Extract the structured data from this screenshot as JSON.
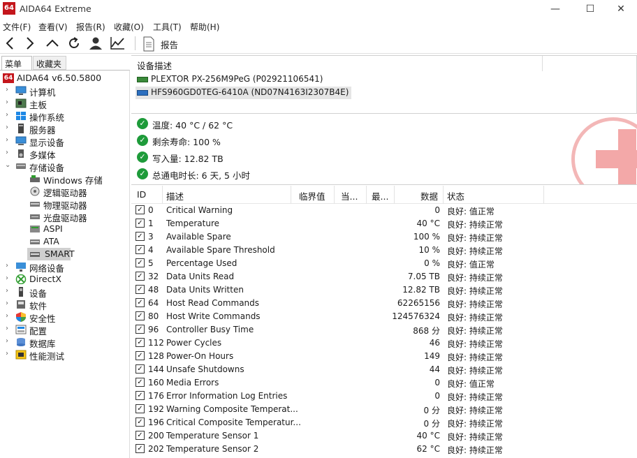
{
  "window": {
    "logo_text": "64",
    "title": "AIDA64 Extreme",
    "minimize": "—",
    "maximize": "☐",
    "close": "✕"
  },
  "menu": [
    "文件(F)",
    "查看(V)",
    "报告(R)",
    "收藏(O)",
    "工具(T)",
    "帮助(H)"
  ],
  "toolbar": {
    "report_label": "报告"
  },
  "left_tabs": {
    "menu": "菜单",
    "favorites": "收藏夹"
  },
  "tree": {
    "root": "AIDA64 v6.50.5800",
    "items": [
      {
        "label": "计算机",
        "expanded": false
      },
      {
        "label": "主板",
        "expanded": false
      },
      {
        "label": "操作系统",
        "expanded": false
      },
      {
        "label": "服务器",
        "expanded": false
      },
      {
        "label": "显示设备",
        "expanded": false
      },
      {
        "label": "多媒体",
        "expanded": false
      },
      {
        "label": "存储设备",
        "expanded": true
      }
    ],
    "storage_children": [
      "Windows 存储",
      "逻辑驱动器",
      "物理驱动器",
      "光盘驱动器",
      "ASPI",
      "ATA",
      "SMART"
    ],
    "items_after": [
      "网络设备",
      "DirectX",
      "设备",
      "软件",
      "安全性",
      "配置",
      "数据库",
      "性能测试"
    ]
  },
  "device_desc": {
    "header": "设备描述",
    "devices": [
      {
        "label": "PLEXTOR PX-256M9PeG (P02921106541)",
        "selected": false
      },
      {
        "label": "HFS960GD0TEG-6410A (ND07N4163I2307B4E)",
        "selected": true
      }
    ]
  },
  "status": [
    "温度: 40 °C / 62 °C",
    "剩余寿命: 100 %",
    "写入量: 12.82 TB",
    "总通电时长: 6 天, 5 小时"
  ],
  "table": {
    "headers": {
      "id": "ID",
      "desc": "描述",
      "threshold": "临界值",
      "current": "当...",
      "worst": "最...",
      "data": "数据",
      "status": "状态"
    },
    "rows": [
      {
        "id": "0",
        "desc": "Critical Warning",
        "data": "0",
        "status": "良好: 值正常"
      },
      {
        "id": "1",
        "desc": "Temperature",
        "data": "40 °C",
        "status": "良好: 持续正常"
      },
      {
        "id": "3",
        "desc": "Available Spare",
        "data": "100 %",
        "status": "良好: 持续正常"
      },
      {
        "id": "4",
        "desc": "Available Spare Threshold",
        "data": "10 %",
        "status": "良好: 持续正常"
      },
      {
        "id": "5",
        "desc": "Percentage Used",
        "data": "0 %",
        "status": "良好: 值正常"
      },
      {
        "id": "32",
        "desc": "Data Units Read",
        "data": "7.05 TB",
        "status": "良好: 持续正常"
      },
      {
        "id": "48",
        "desc": "Data Units Written",
        "data": "12.82 TB",
        "status": "良好: 持续正常"
      },
      {
        "id": "64",
        "desc": "Host Read Commands",
        "data": "62265156",
        "status": "良好: 持续正常"
      },
      {
        "id": "80",
        "desc": "Host Write Commands",
        "data": "124576324",
        "status": "良好: 持续正常"
      },
      {
        "id": "96",
        "desc": "Controller Busy Time",
        "data": "868 分",
        "status": "良好: 持续正常"
      },
      {
        "id": "112",
        "desc": "Power Cycles",
        "data": "46",
        "status": "良好: 持续正常"
      },
      {
        "id": "128",
        "desc": "Power-On Hours",
        "data": "149",
        "status": "良好: 持续正常"
      },
      {
        "id": "144",
        "desc": "Unsafe Shutdowns",
        "data": "44",
        "status": "良好: 持续正常"
      },
      {
        "id": "160",
        "desc": "Media Errors",
        "data": "0",
        "status": "良好: 值正常"
      },
      {
        "id": "176",
        "desc": "Error Information Log Entries",
        "data": "0",
        "status": "良好: 持续正常"
      },
      {
        "id": "192",
        "desc": "Warning Composite Temperat...",
        "data": "0 分",
        "status": "良好: 持续正常"
      },
      {
        "id": "196",
        "desc": "Critical Composite Temperatur...",
        "data": "0 分",
        "status": "良好: 持续正常"
      },
      {
        "id": "200",
        "desc": "Temperature Sensor 1",
        "data": "40 °C",
        "status": "良好: 持续正常"
      },
      {
        "id": "202",
        "desc": "Temperature Sensor 2",
        "data": "62 °C",
        "status": "良好: 持续正常"
      }
    ]
  },
  "colors": {
    "accent_red": "#c4161c",
    "ok_green": "#1e9b3a",
    "selection": "#cce8ff"
  }
}
